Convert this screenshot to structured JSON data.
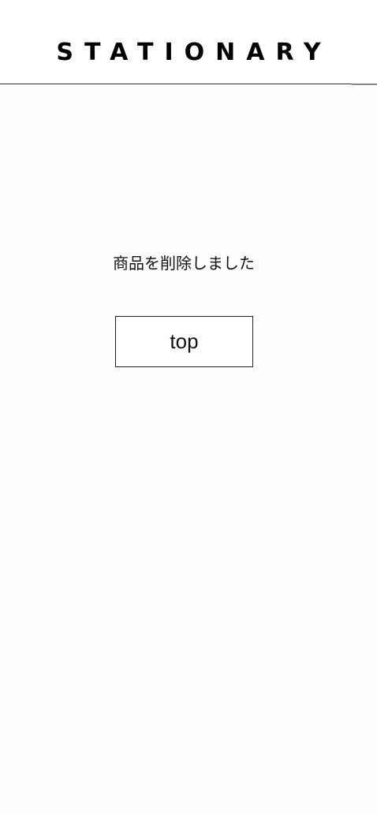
{
  "header": {
    "logo_text": "STATIONARY"
  },
  "main": {
    "message": "商品を削除しました",
    "top_button_label": "top"
  }
}
